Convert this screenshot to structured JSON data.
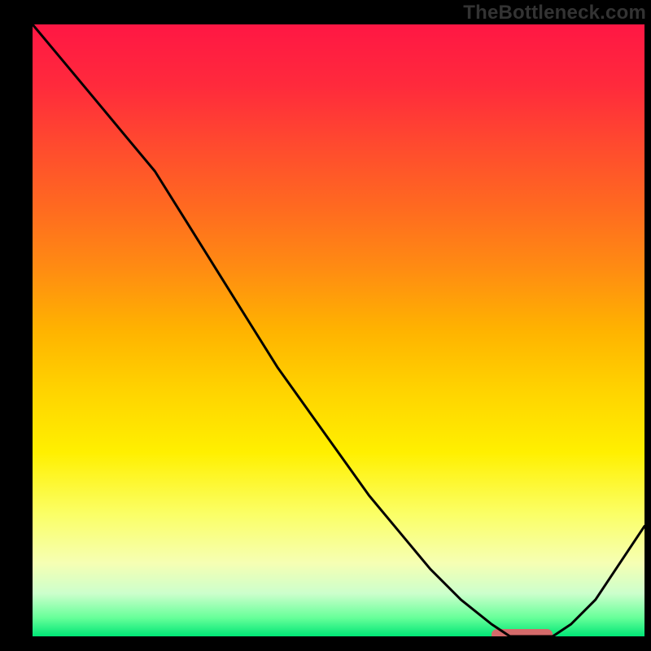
{
  "brand": "TheBottleneck.com",
  "chart_data": {
    "type": "line",
    "title": "",
    "xlabel": "",
    "ylabel": "",
    "xlim": [
      0,
      100
    ],
    "ylim": [
      0,
      100
    ],
    "x": [
      0,
      5,
      10,
      15,
      20,
      25,
      30,
      35,
      40,
      45,
      50,
      55,
      60,
      65,
      70,
      75,
      78,
      82,
      85,
      88,
      92,
      100
    ],
    "values": [
      100,
      94,
      88,
      82,
      76,
      68,
      60,
      52,
      44,
      37,
      30,
      23,
      17,
      11,
      6,
      2,
      0,
      0,
      0,
      2,
      6,
      18
    ],
    "gradient_stops": [
      {
        "pos": 0.0,
        "color": "#ff1744"
      },
      {
        "pos": 0.1,
        "color": "#ff2a3c"
      },
      {
        "pos": 0.2,
        "color": "#ff4b2e"
      },
      {
        "pos": 0.3,
        "color": "#ff6a20"
      },
      {
        "pos": 0.4,
        "color": "#ff8c12"
      },
      {
        "pos": 0.5,
        "color": "#ffb300"
      },
      {
        "pos": 0.6,
        "color": "#ffd400"
      },
      {
        "pos": 0.7,
        "color": "#fff000"
      },
      {
        "pos": 0.8,
        "color": "#fbff66"
      },
      {
        "pos": 0.88,
        "color": "#f6ffb3"
      },
      {
        "pos": 0.93,
        "color": "#ccffcc"
      },
      {
        "pos": 0.97,
        "color": "#66ff99"
      },
      {
        "pos": 1.0,
        "color": "#00e676"
      }
    ],
    "marker": {
      "x_start": 75,
      "x_end": 85,
      "y": 0,
      "color": "#d46a6a"
    }
  }
}
